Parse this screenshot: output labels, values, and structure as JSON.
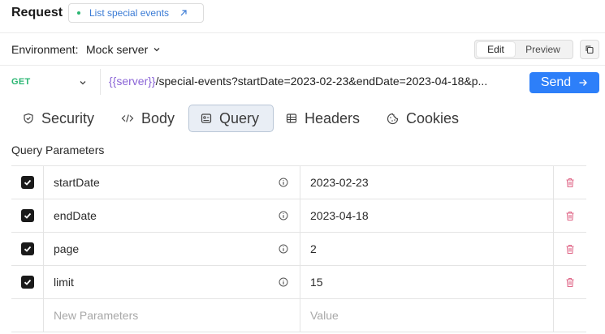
{
  "header": {
    "title": "Request",
    "operation_label": "List special events"
  },
  "environment": {
    "label": "Environment:",
    "value": "Mock server",
    "mode_options": [
      "Edit",
      "Preview"
    ],
    "active_mode": "Edit"
  },
  "request": {
    "method": "GET",
    "url_variable": "{{server}}",
    "url_path": "/special-events?startDate=2023-02-23&endDate=2023-04-18&p...",
    "send_label": "Send"
  },
  "tabs": [
    {
      "label": "Security",
      "icon": "shield-icon",
      "active": false
    },
    {
      "label": "Body",
      "icon": "code-icon",
      "active": false
    },
    {
      "label": "Query",
      "icon": "query-icon",
      "active": true
    },
    {
      "label": "Headers",
      "icon": "headers-icon",
      "active": false
    },
    {
      "label": "Cookies",
      "icon": "cookie-icon",
      "active": false
    }
  ],
  "query": {
    "section_title": "Query Parameters",
    "params": [
      {
        "key": "startDate",
        "value": "2023-02-23",
        "enabled": true
      },
      {
        "key": "endDate",
        "value": "2023-04-18",
        "enabled": true
      },
      {
        "key": "page",
        "value": "2",
        "enabled": true
      },
      {
        "key": "limit",
        "value": "15",
        "enabled": true
      }
    ],
    "new_key_placeholder": "New Parameters",
    "new_value_placeholder": "Value"
  },
  "colors": {
    "method_get": "#2bb673",
    "link": "#3a7bd5",
    "url_variable": "#8a64d6",
    "send": "#2d7ff9",
    "delete": "#e06a8a"
  }
}
